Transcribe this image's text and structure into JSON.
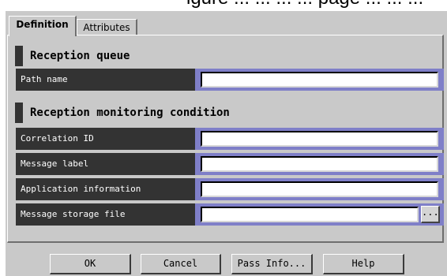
{
  "page_caption_fragment": "igure ... ... ... ... page ... ... ...",
  "tabs": [
    {
      "label": "Definition",
      "selected": true
    },
    {
      "label": "Attributes",
      "selected": false
    }
  ],
  "sections": {
    "reception_queue": "Reception queue",
    "monitoring_condition": "Reception monitoring condition"
  },
  "fields": {
    "path_name": {
      "label": "Path name",
      "value": ""
    },
    "correlation_id": {
      "label": "Correlation ID",
      "value": ""
    },
    "message_label": {
      "label": "Message label",
      "value": ""
    },
    "application_information": {
      "label": "Application information",
      "value": ""
    },
    "message_storage_file": {
      "label": "Message storage file",
      "value": "",
      "browse_label": "..."
    }
  },
  "buttons": {
    "ok": "OK",
    "cancel": "Cancel",
    "pass_info": "Pass Info...",
    "help": "Help"
  },
  "colors": {
    "dialog_bg": "#c9c9c9",
    "label_bg": "#333333",
    "field_frame": "#7f7fc8"
  }
}
